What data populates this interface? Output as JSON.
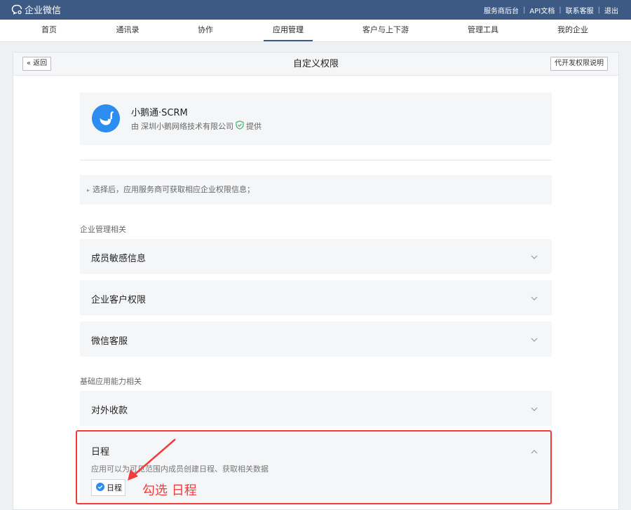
{
  "topbar": {
    "logo_text": "企业微信",
    "links": [
      "服务商后台",
      "API文档",
      "联系客服",
      "退出"
    ]
  },
  "nav": {
    "items": [
      "首页",
      "通讯录",
      "协作",
      "应用管理",
      "客户与上下游",
      "管理工具",
      "我的企业"
    ],
    "active": "应用管理"
  },
  "page": {
    "back_label": "« 返回",
    "title": "自定义权限",
    "help_label": "代开发权限说明"
  },
  "app": {
    "name": "小鹅通·SCRM",
    "vendor_prefix": "由",
    "vendor": "深圳小鹅网络技术有限公司",
    "vendor_suffix": "提供"
  },
  "notice": "选择后，应用服务商可获取相应企业权限信息；",
  "sections": [
    {
      "label": "企业管理相关",
      "items": [
        "成员敏感信息",
        "企业客户权限",
        "微信客服"
      ]
    },
    {
      "label": "基础应用能力相关",
      "items": [
        "对外收款"
      ]
    }
  ],
  "expanded": {
    "title": "日程",
    "description": "应用可以为可见范围内成员创建日程、获取相关数据",
    "checkbox_label": "日程",
    "checked": true
  },
  "annotation": {
    "text": "勾选 日程",
    "color": "#f23b3b"
  },
  "colors": {
    "topbar": "#3d5a84",
    "accent": "#2d8cf0",
    "panel": "#f5f6f8"
  }
}
